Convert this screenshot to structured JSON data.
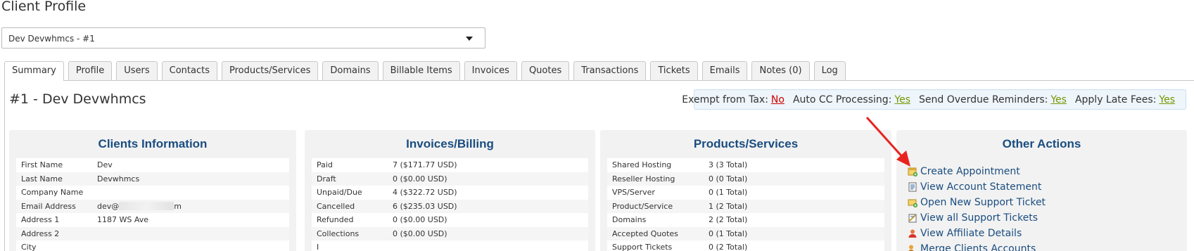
{
  "page": {
    "title": "Client Profile"
  },
  "client_select": {
    "value": "Dev Devwhmcs - #1"
  },
  "tabs": [
    {
      "label": "Summary",
      "active": true
    },
    {
      "label": "Profile"
    },
    {
      "label": "Users"
    },
    {
      "label": "Contacts"
    },
    {
      "label": "Products/Services"
    },
    {
      "label": "Domains"
    },
    {
      "label": "Billable Items"
    },
    {
      "label": "Invoices"
    },
    {
      "label": "Quotes"
    },
    {
      "label": "Transactions"
    },
    {
      "label": "Tickets"
    },
    {
      "label": "Emails"
    },
    {
      "label": "Notes (0)"
    },
    {
      "label": "Log"
    }
  ],
  "client_heading": "#1 - Dev Devwhmcs",
  "flags": {
    "exempt_tax": {
      "label": "Exempt from Tax:",
      "value": "No"
    },
    "auto_cc": {
      "label": "Auto CC Processing:",
      "value": "Yes"
    },
    "overdue_reminders": {
      "label": "Send Overdue Reminders:",
      "value": "Yes"
    },
    "late_fees": {
      "label": "Apply Late Fees:",
      "value": "Yes"
    },
    "colors": {
      "no": "#cc0000",
      "yes": "#779500"
    }
  },
  "clients_info": {
    "title": "Clients Information",
    "rows": [
      {
        "label": "First Name",
        "value": "Dev"
      },
      {
        "label": "Last Name",
        "value": "Devwhmcs"
      },
      {
        "label": "Company Name",
        "value": ""
      },
      {
        "label": "Email Address",
        "value_prefix": "dev@",
        "value_suffix": "m"
      },
      {
        "label": "Address 1",
        "value": "1187 WS Ave"
      },
      {
        "label": "Address 2",
        "value": ""
      },
      {
        "label": "City",
        "value": ""
      }
    ]
  },
  "invoices_billing": {
    "title": "Invoices/Billing",
    "rows": [
      {
        "label": "Paid",
        "value": "7 ($171.77 USD)"
      },
      {
        "label": "Draft",
        "value": "0 ($0.00 USD)"
      },
      {
        "label": "Unpaid/Due",
        "value": "4 ($322.72 USD)"
      },
      {
        "label": "Cancelled",
        "value": "6 ($235.03 USD)"
      },
      {
        "label": "Refunded",
        "value": "0 ($0.00 USD)"
      },
      {
        "label": "Collections",
        "value": "0 ($0.00 USD)"
      },
      {
        "label": "I",
        "value": ""
      }
    ]
  },
  "products_services": {
    "title": "Products/Services",
    "rows": [
      {
        "label": "Shared Hosting",
        "value": "3 (3 Total)"
      },
      {
        "label": "Reseller Hosting",
        "value": "0 (0 Total)"
      },
      {
        "label": "VPS/Server",
        "value": "0 (1 Total)"
      },
      {
        "label": "Product/Service",
        "value": "1 (2 Total)"
      },
      {
        "label": "Domains",
        "value": "2 (2 Total)"
      },
      {
        "label": "Accepted Quotes",
        "value": "0 (1 Total)"
      },
      {
        "label": "Support Tickets",
        "value": "0 (2 Total)"
      }
    ]
  },
  "other_actions": {
    "title": "Other Actions",
    "items": [
      {
        "label": "Create Appointment",
        "icon": "calendar-add-icon"
      },
      {
        "label": "View Account Statement",
        "icon": "statement-icon"
      },
      {
        "label": "Open New Support Ticket",
        "icon": "ticket-add-icon"
      },
      {
        "label": "View all Support Tickets",
        "icon": "tickets-icon"
      },
      {
        "label": "View Affiliate Details",
        "icon": "affiliate-icon"
      },
      {
        "label": "Merge Clients Accounts",
        "icon": "merge-icon"
      }
    ]
  }
}
